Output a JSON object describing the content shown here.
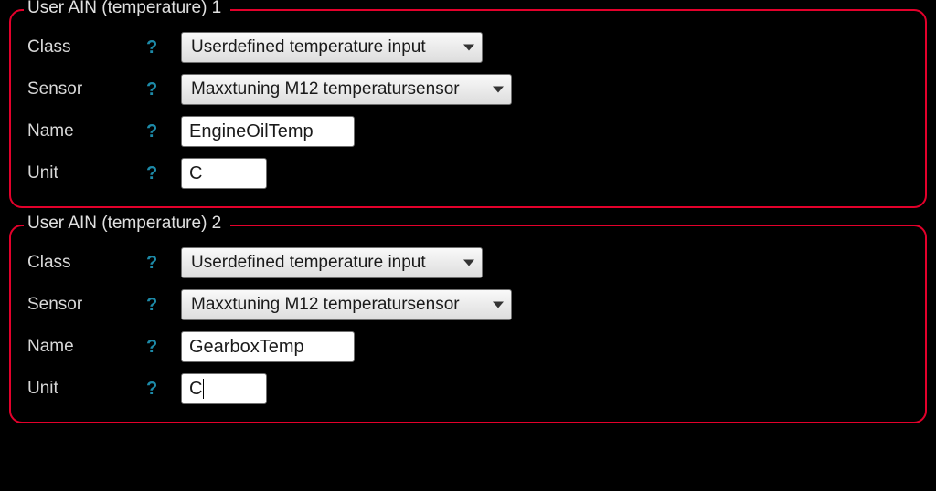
{
  "panels": [
    {
      "title": "User AIN (temperature) 1",
      "fields": {
        "class_label": "Class",
        "class_value": "Userdefined temperature input",
        "sensor_label": "Sensor",
        "sensor_value": "Maxxtuning M12 temperatursensor",
        "name_label": "Name",
        "name_value": "EngineOilTemp",
        "unit_label": "Unit",
        "unit_value": "C"
      }
    },
    {
      "title": "User AIN (temperature) 2",
      "fields": {
        "class_label": "Class",
        "class_value": "Userdefined temperature input",
        "sensor_label": "Sensor",
        "sensor_value": "Maxxtuning M12 temperatursensor",
        "name_label": "Name",
        "name_value": "GearboxTemp",
        "unit_label": "Unit",
        "unit_value": "C"
      }
    }
  ],
  "help_symbol": "?"
}
